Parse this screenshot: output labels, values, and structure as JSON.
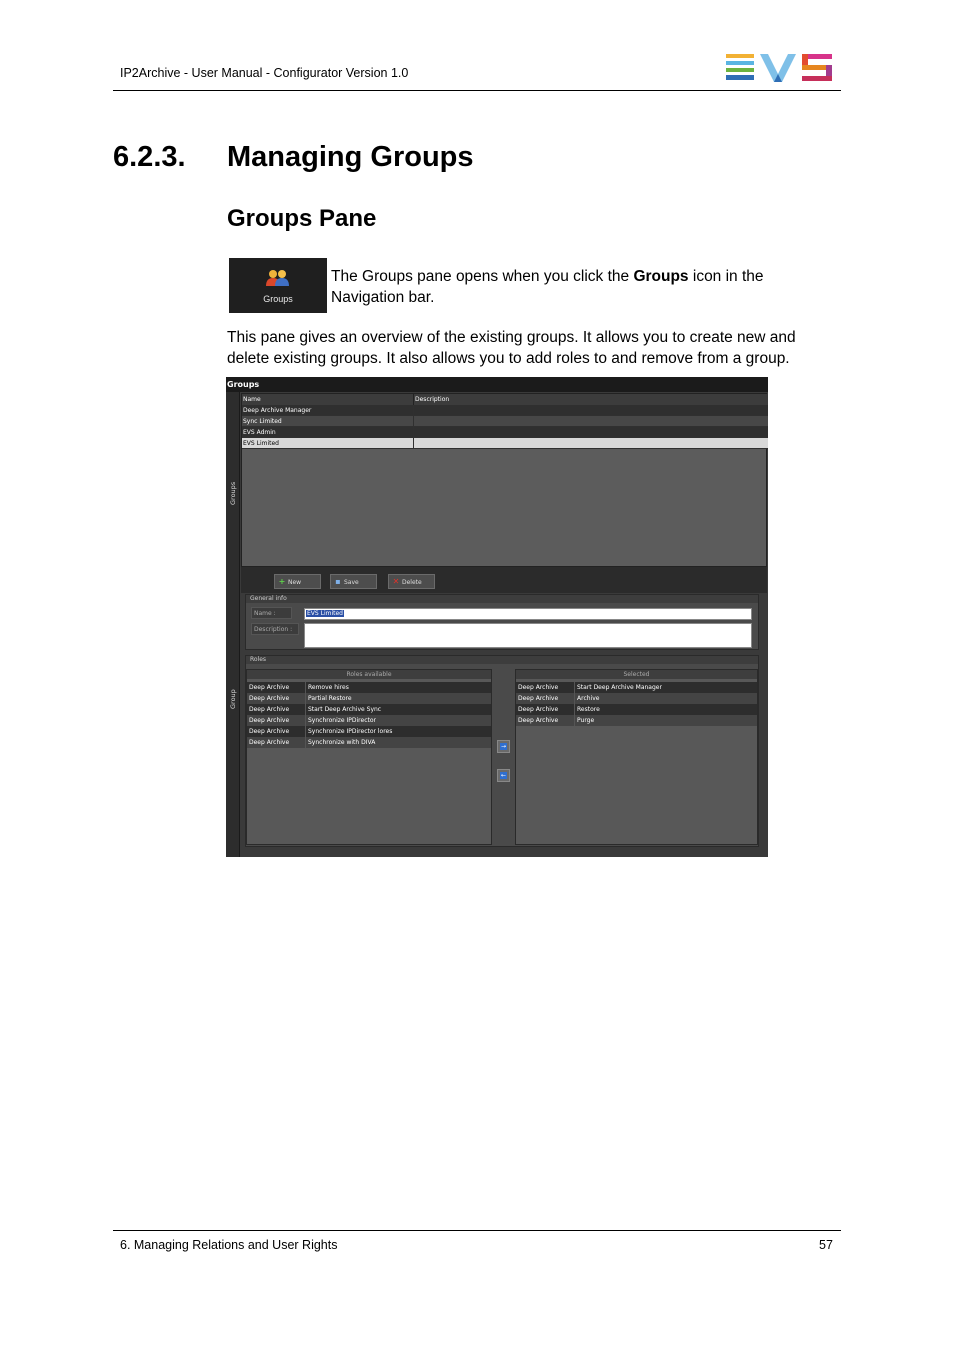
{
  "header": {
    "title": "IP2Archive - User Manual - Configurator Version 1.0",
    "logo_text": "EVS"
  },
  "section": {
    "number": "6.2.3.",
    "title": "Managing Groups",
    "subtitle": "Groups Pane"
  },
  "nav_icon": {
    "label": "Groups",
    "icon": "people-icon"
  },
  "intro": {
    "before": "The Groups pane opens when you click the ",
    "bold": "Groups",
    "after": " icon in the Navigation bar."
  },
  "overview": "This pane gives an overview of the existing groups. It allows you to create new and delete existing groups. It also allows you to add roles to and remove from a group.",
  "screenshot": {
    "title": "Groups",
    "side_tab_top": "Groups",
    "side_tab_bottom": "Group",
    "grid": {
      "columns": [
        "Name",
        "Description"
      ],
      "rows": [
        {
          "name": "Deep Archive Manager",
          "description": ""
        },
        {
          "name": "Sync Limited",
          "description": ""
        },
        {
          "name": "EVS Admin",
          "description": ""
        },
        {
          "name": "EVS Limited",
          "description": ""
        }
      ]
    },
    "toolbar": {
      "new_label": "New",
      "save_label": "Save",
      "delete_label": "Delete"
    },
    "general_info": {
      "title": "General info",
      "name_label": "Name :",
      "name_value": "EVS Limited",
      "description_label": "Description :",
      "description_value": ""
    },
    "roles": {
      "title": "Roles",
      "available_header": "Roles available",
      "selected_header": "Selected",
      "available": [
        {
          "module": "Deep Archive",
          "role": "Remove hires"
        },
        {
          "module": "Deep Archive",
          "role": "Partial Restore"
        },
        {
          "module": "Deep Archive",
          "role": "Start Deep Archive Sync"
        },
        {
          "module": "Deep Archive",
          "role": "Synchronize IPDirector"
        },
        {
          "module": "Deep Archive",
          "role": "Synchronize IPDirector lores"
        },
        {
          "module": "Deep Archive",
          "role": "Synchronize with DIVA"
        }
      ],
      "selected": [
        {
          "module": "Deep Archive",
          "role": "Start Deep Archive Manager"
        },
        {
          "module": "Deep Archive",
          "role": "Archive"
        },
        {
          "module": "Deep Archive",
          "role": "Restore"
        },
        {
          "module": "Deep Archive",
          "role": "Purge"
        }
      ],
      "add_icon": "arrow-right-icon",
      "remove_icon": "arrow-left-icon"
    }
  },
  "footer": {
    "chapter": "6. Managing Relations and User Rights",
    "page": "57"
  }
}
